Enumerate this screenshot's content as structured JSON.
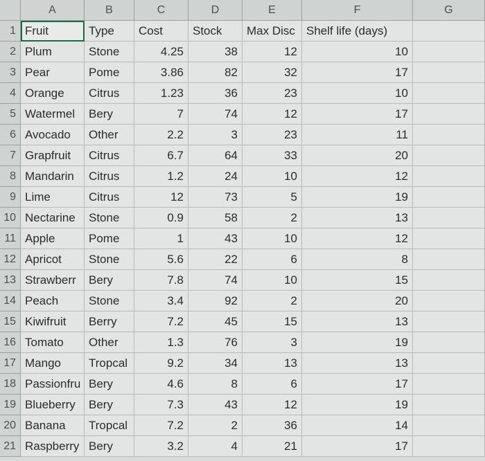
{
  "columns": [
    "A",
    "B",
    "C",
    "D",
    "E",
    "F",
    "G"
  ],
  "headers": [
    "Fruit",
    "Type",
    "Cost",
    "Stock",
    "Max Disc",
    "Shelf life (days)",
    ""
  ],
  "rows": [
    {
      "fruit": "Plum",
      "type": "Stone",
      "cost": "4.25",
      "stock": "38",
      "maxdisc": "12",
      "shelf": "10"
    },
    {
      "fruit": "Pear",
      "type": "Pome",
      "cost": "3.86",
      "stock": "82",
      "maxdisc": "32",
      "shelf": "17"
    },
    {
      "fruit": "Orange",
      "type": "Citrus",
      "cost": "1.23",
      "stock": "36",
      "maxdisc": "23",
      "shelf": "10"
    },
    {
      "fruit": "Watermel",
      "type": "Bery",
      "cost": "7",
      "stock": "74",
      "maxdisc": "12",
      "shelf": "17"
    },
    {
      "fruit": "Avocado",
      "type": "Other",
      "cost": "2.2",
      "stock": "3",
      "maxdisc": "23",
      "shelf": "11"
    },
    {
      "fruit": "Grapfruit",
      "type": "Citrus",
      "cost": "6.7",
      "stock": "64",
      "maxdisc": "33",
      "shelf": "20"
    },
    {
      "fruit": "Mandarin",
      "type": "Citrus",
      "cost": "1.2",
      "stock": "24",
      "maxdisc": "10",
      "shelf": "12"
    },
    {
      "fruit": "Lime",
      "type": "Citrus",
      "cost": "12",
      "stock": "73",
      "maxdisc": "5",
      "shelf": "19"
    },
    {
      "fruit": "Nectarine",
      "type": "Stone",
      "cost": "0.9",
      "stock": "58",
      "maxdisc": "2",
      "shelf": "13"
    },
    {
      "fruit": "Apple",
      "type": "Pome",
      "cost": "1",
      "stock": "43",
      "maxdisc": "10",
      "shelf": "12"
    },
    {
      "fruit": "Apricot",
      "type": "Stone",
      "cost": "5.6",
      "stock": "22",
      "maxdisc": "6",
      "shelf": "8"
    },
    {
      "fruit": "Strawberr",
      "type": "Bery",
      "cost": "7.8",
      "stock": "74",
      "maxdisc": "10",
      "shelf": "15"
    },
    {
      "fruit": "Peach",
      "type": "Stone",
      "cost": "3.4",
      "stock": "92",
      "maxdisc": "2",
      "shelf": "20"
    },
    {
      "fruit": "Kiwifruit",
      "type": "Berry",
      "cost": "7.2",
      "stock": "45",
      "maxdisc": "15",
      "shelf": "13"
    },
    {
      "fruit": "Tomato",
      "type": "Other",
      "cost": "1.3",
      "stock": "76",
      "maxdisc": "3",
      "shelf": "19"
    },
    {
      "fruit": "Mango",
      "type": "Tropcal",
      "cost": "9.2",
      "stock": "34",
      "maxdisc": "13",
      "shelf": "13"
    },
    {
      "fruit": "Passionfru",
      "type": "Bery",
      "cost": "4.6",
      "stock": "8",
      "maxdisc": "6",
      "shelf": "17"
    },
    {
      "fruit": "Blueberry",
      "type": "Bery",
      "cost": "7.3",
      "stock": "43",
      "maxdisc": "12",
      "shelf": "19"
    },
    {
      "fruit": "Banana",
      "type": "Tropcal",
      "cost": "7.2",
      "stock": "2",
      "maxdisc": "36",
      "shelf": "14"
    },
    {
      "fruit": "Raspberry",
      "type": "Bery",
      "cost": "3.2",
      "stock": "4",
      "maxdisc": "21",
      "shelf": "17"
    }
  ],
  "active_cell": "A1"
}
